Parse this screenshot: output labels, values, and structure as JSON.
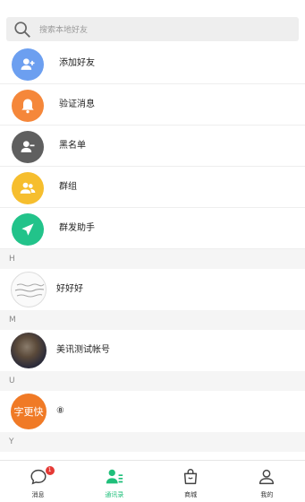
{
  "search": {
    "placeholder": "搜索本地好友"
  },
  "functions": [
    {
      "label": "添加好友",
      "icon": "add-friend-icon",
      "color": "#6c9ff0"
    },
    {
      "label": "验证消息",
      "icon": "bell-icon",
      "color": "#f5873a"
    },
    {
      "label": "黑名单",
      "icon": "blacklist-icon",
      "color": "#5f5f5f"
    },
    {
      "label": "群组",
      "icon": "group-icon",
      "color": "#f6be2e"
    },
    {
      "label": "群发助手",
      "icon": "send-icon",
      "color": "#22c38a"
    }
  ],
  "sections": [
    {
      "letter": "H",
      "contacts": [
        {
          "name": "好好好"
        }
      ]
    },
    {
      "letter": "M",
      "contacts": [
        {
          "name": "美讯测试帐号"
        }
      ]
    },
    {
      "letter": "U",
      "contacts": [
        {
          "name": "⑧",
          "avatar_text": "字更快"
        }
      ]
    },
    {
      "letter": "Y",
      "contacts": []
    }
  ],
  "tabs": [
    {
      "label": "消息",
      "icon": "chat-bubble-icon",
      "badge": "1"
    },
    {
      "label": "通讯录",
      "icon": "contacts-icon",
      "active": true
    },
    {
      "label": "商城",
      "icon": "shopping-bag-icon"
    },
    {
      "label": "我的",
      "icon": "profile-icon"
    }
  ],
  "colors": {
    "accent": "#1fbf7a",
    "badge": "#e53935"
  }
}
